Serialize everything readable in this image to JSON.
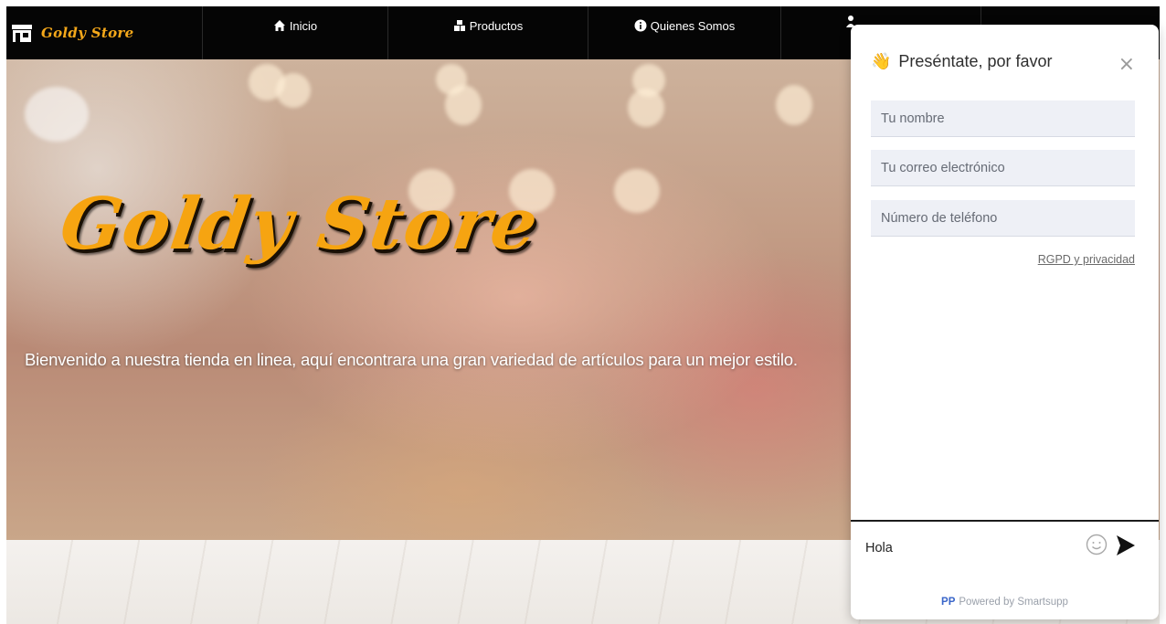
{
  "navbar": {
    "brand": "Goldy Store",
    "brand_icon": "store-icon",
    "items": [
      {
        "label": "Inicio",
        "icon": "home-icon"
      },
      {
        "label": "Productos",
        "icon": "cubes-icon"
      },
      {
        "label": "Quienes Somos",
        "icon": "info-circle-icon"
      }
    ]
  },
  "hero": {
    "title": "Goldy Store",
    "welcome": "Bienvenido a nuestra tienda en linea, aquí encontrara una gran variedad de artículos para un mejor estilo."
  },
  "chat": {
    "wave_icon": "👋",
    "title": "Preséntate, por favor",
    "close_icon": "×",
    "fields": {
      "name_placeholder": "Tu nombre",
      "email_placeholder": "Tu correo electrónico",
      "phone_placeholder": "Número de teléfono"
    },
    "gdpr_link": "RGPD y privacidad",
    "message_value": "Hola",
    "powered_logo": "PP",
    "powered_text": "Powered by Smartsupp"
  },
  "colors": {
    "accent": "#f6a411",
    "navbar_bg": "#050505",
    "field_bg": "#eef0f6",
    "powered_link": "#3a66c9"
  }
}
